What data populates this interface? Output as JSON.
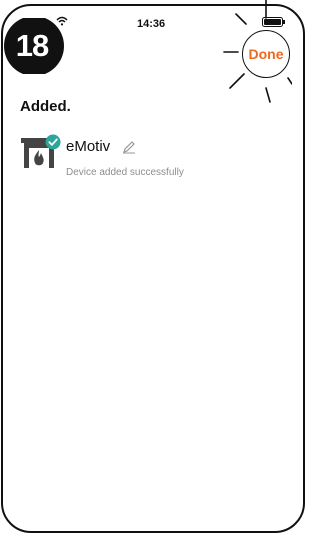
{
  "status_bar": {
    "time": "14:36",
    "icons": [
      "wifi-icon",
      "battery-icon"
    ]
  },
  "step": {
    "number": "18"
  },
  "header": {
    "done_label": "Done"
  },
  "page": {
    "title": "Added."
  },
  "device": {
    "name": "eMotiv",
    "status": "Device added successfully",
    "icon": "fireplace-icon",
    "badge_icon": "check-circle-icon",
    "edit_icon": "pencil-icon"
  },
  "colors": {
    "accent": "#ec6a1f",
    "success": "#2aa59a",
    "text": "#111111",
    "muted": "#8e8e8e"
  }
}
